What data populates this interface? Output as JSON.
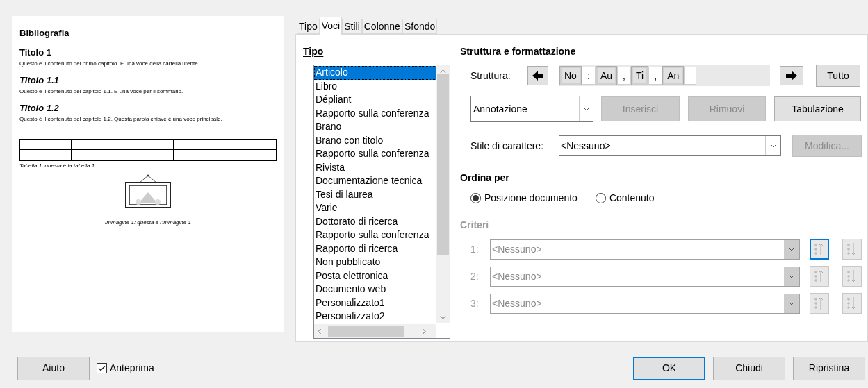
{
  "preview": {
    "heading": "Bibliografia",
    "sections": [
      {
        "title": "Titolo 1",
        "italic": false,
        "text": "Questo è il contenuto del primo capitolo. E una voce della cartella utente."
      },
      {
        "title": "Titolo 1.1",
        "italic": true,
        "text": "Questo è il contenuto del capitolo 1.1. E una voce per il sommario."
      },
      {
        "title": "Titolo 1.2",
        "italic": true,
        "text": "Questo è il contenuto del capitolo 1.2. Questa parola chiave è una voce principale."
      }
    ],
    "table_caption": "Tabella 1: questa è la tabella 1",
    "image_caption": "Immagine 1: questa è l'immagine 1"
  },
  "tabs": [
    {
      "label": "Tipo",
      "selected": false
    },
    {
      "label": "Voci",
      "selected": true
    },
    {
      "label": "Stili",
      "selected": false
    },
    {
      "label": "Colonne",
      "selected": false
    },
    {
      "label": "Sfondo",
      "selected": false
    }
  ],
  "type_list": {
    "label": "Tipo",
    "items": [
      {
        "label": "Articolo",
        "selected": true
      },
      {
        "label": "Libro",
        "selected": false
      },
      {
        "label": "Dépliant",
        "selected": false
      },
      {
        "label": "Rapporto sulla conferenza",
        "selected": false
      },
      {
        "label": "Brano",
        "selected": false
      },
      {
        "label": "Brano con titolo",
        "selected": false
      },
      {
        "label": "Rapporto sulla conferenza",
        "selected": false
      },
      {
        "label": "Rivista",
        "selected": false
      },
      {
        "label": "Documentazione tecnica",
        "selected": false
      },
      {
        "label": "Tesi di laurea",
        "selected": false
      },
      {
        "label": "Varie",
        "selected": false
      },
      {
        "label": "Dottorato di ricerca",
        "selected": false
      },
      {
        "label": "Rapporto sulla conferenza",
        "selected": false
      },
      {
        "label": "Rapporto di ricerca",
        "selected": false
      },
      {
        "label": "Non pubblicato",
        "selected": false
      },
      {
        "label": "Posta elettronica",
        "selected": false
      },
      {
        "label": "Documento web",
        "selected": false
      },
      {
        "label": "Personalizzato1",
        "selected": false
      },
      {
        "label": "Personalizzato2",
        "selected": false
      }
    ]
  },
  "structure": {
    "title": "Struttura e formattazione",
    "label": "Struttura:",
    "tokens": [
      {
        "text": "No",
        "kind": "entry"
      },
      {
        "text": ":",
        "kind": "text"
      },
      {
        "text": "Au",
        "kind": "entry"
      },
      {
        "text": ",",
        "kind": "text"
      },
      {
        "text": "Ti",
        "kind": "entry"
      },
      {
        "text": ",",
        "kind": "text"
      },
      {
        "text": "An",
        "kind": "entry"
      }
    ],
    "all_button": "Tutto",
    "field_dropdown": "Annotazione",
    "buttons": [
      {
        "label": "Inserisci",
        "disabled": true
      },
      {
        "label": "Rimuovi",
        "disabled": true
      },
      {
        "label": "Tabulazione",
        "disabled": false
      }
    ],
    "char_style_label": "Stile di carattere:",
    "char_style": "<Nessuno>",
    "edit_button": {
      "label": "Modifica...",
      "disabled": true
    }
  },
  "sort": {
    "title": "Ordina per",
    "options": [
      {
        "label": "Posizione documento",
        "selected": true
      },
      {
        "label": "Contenuto",
        "selected": false
      }
    ]
  },
  "criteria": {
    "title": "Criteri",
    "disabled": true,
    "rows": [
      {
        "label": "1:",
        "value": "<Nessuno>",
        "focused": true
      },
      {
        "label": "2:",
        "value": "<Nessuno>",
        "focused": false
      },
      {
        "label": "3:",
        "value": "<Nessuno>",
        "focused": false
      }
    ]
  },
  "footer": {
    "help": "Aiuto",
    "preview_check": {
      "label": "Anteprima",
      "checked": true
    },
    "buttons": [
      {
        "label": "OK",
        "default": true
      },
      {
        "label": "Chiudi",
        "default": false
      },
      {
        "label": "Ripristina",
        "default": false
      }
    ]
  }
}
